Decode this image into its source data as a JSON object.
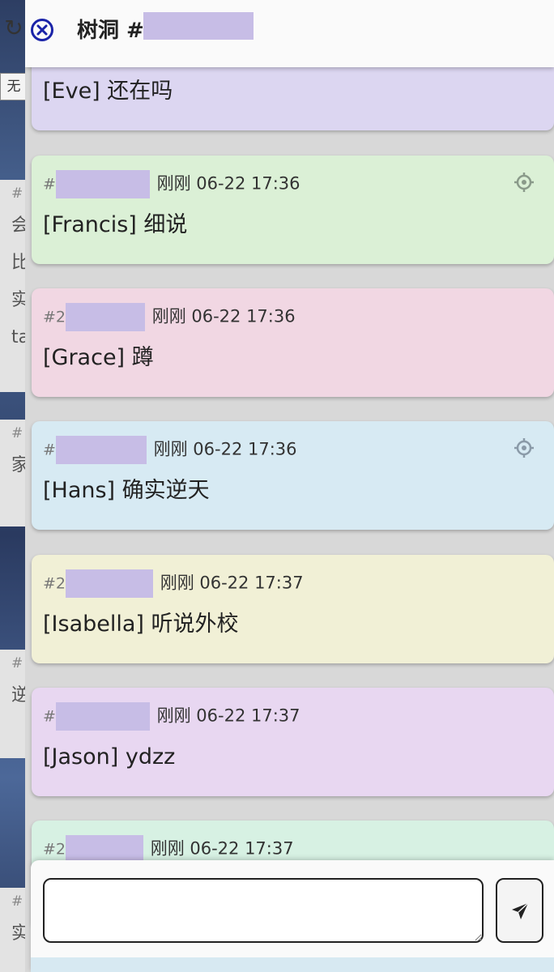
{
  "background_app": {
    "refresh_icon": "refresh-icon",
    "filter_box": "无",
    "cards": [
      {
        "hash": "#",
        "lines": [
          "会",
          "比",
          "实",
          "ta"
        ]
      },
      {
        "hash": "#",
        "lines": [
          "家"
        ]
      },
      {
        "hash": "#",
        "lines": [
          "逆"
        ]
      },
      {
        "hash": "#",
        "lines": [
          "实"
        ]
      }
    ]
  },
  "header": {
    "close_icon": "close-circle-icon",
    "title": "树洞 #",
    "accent_color": "#1a23a8"
  },
  "messages": [
    {
      "id_prefix": "",
      "time": "",
      "text": "[Eve] 还在吗",
      "color": "#dcd6f1",
      "locate": false
    },
    {
      "id_prefix": "#",
      "time": "刚刚 06-22 17:36",
      "text": "[Francis] 细说",
      "color": "#dbf0d6",
      "locate": true
    },
    {
      "id_prefix": "#2",
      "time": "刚刚 06-22 17:36",
      "text": "[Grace] 蹲",
      "color": "#f1d7e3",
      "locate": false
    },
    {
      "id_prefix": "#",
      "time": "刚刚 06-22 17:36",
      "text": "[Hans] 确实逆天",
      "color": "#d7eaf3",
      "locate": true
    },
    {
      "id_prefix": "#2",
      "time": "刚刚 06-22 17:37",
      "text": "[Isabella] 听说外校",
      "color": "#f1f0d6",
      "locate": false
    },
    {
      "id_prefix": "#",
      "time": "刚刚 06-22 17:37",
      "text": "[Jason] ydzz",
      "color": "#e8d7f1",
      "locate": false
    },
    {
      "id_prefix": "#2",
      "time": "刚刚 06-22 17:37",
      "text": "",
      "color": "#d7f1e3",
      "locate": false
    }
  ],
  "composer": {
    "input_value": "",
    "input_placeholder": "",
    "send_icon": "send-icon"
  }
}
